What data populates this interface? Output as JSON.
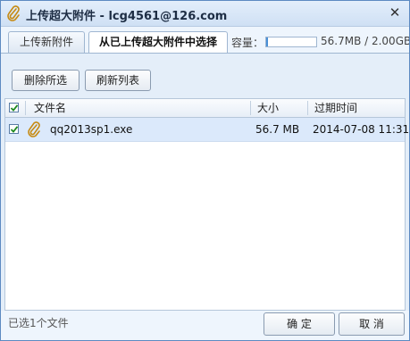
{
  "window": {
    "title": "上传超大附件 - lcg4561@126.com",
    "close_glyph": "✕",
    "icon": "paperclip-icon",
    "close_icon": "close-icon"
  },
  "tabs": [
    {
      "label": "上传新附件",
      "active": false
    },
    {
      "label": "从已上传超大附件中选择",
      "active": true
    }
  ],
  "quota": {
    "label": "容量：",
    "used_text": "56.7MB / 2.00GB",
    "used_fraction": 0.028
  },
  "toolbar": {
    "delete_label": "删除所选",
    "refresh_label": "刷新列表"
  },
  "table": {
    "headers": {
      "name": "文件名",
      "size": "大小",
      "expires": "过期时间"
    },
    "header_checked": true,
    "rows": [
      {
        "checked": true,
        "icon": "paperclip-icon",
        "name": "qq2013sp1.exe",
        "size": "56.7 MB",
        "expires": "2014-07-08  11:31"
      }
    ]
  },
  "footer": {
    "status": "已选1个文件",
    "ok_label": "确 定",
    "cancel_label": "取 消"
  },
  "colors": {
    "accent": "#4a90d6",
    "selected_row": "#dbe9fb",
    "panel": "#e4eef9"
  }
}
